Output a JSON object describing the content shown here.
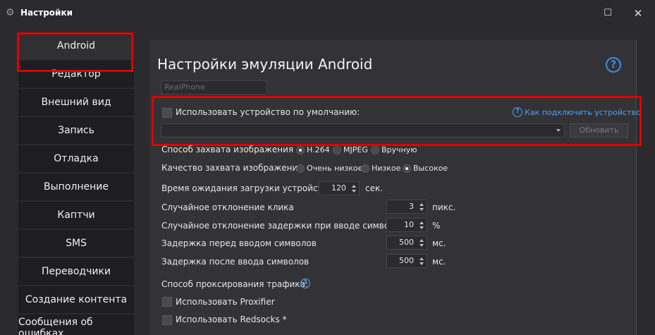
{
  "window": {
    "title": "Настройки",
    "maximize_glyph": "☐",
    "close_glyph": "✕"
  },
  "sidebar": {
    "items": [
      {
        "label": "Android",
        "active": true
      },
      {
        "label": "Редактор"
      },
      {
        "label": "Внешний вид"
      },
      {
        "label": "Запись"
      },
      {
        "label": "Отладка"
      },
      {
        "label": "Выполнение"
      },
      {
        "label": "Каптчи"
      },
      {
        "label": "SMS"
      },
      {
        "label": "Переводчики"
      },
      {
        "label": "Создание контента"
      },
      {
        "label": "Сообщения об ошибках"
      }
    ]
  },
  "main": {
    "title": "Настройки эмуляции Android",
    "help_glyph": "?",
    "device_name_value": "RealPhone",
    "default_device": {
      "checkbox_label": "Использовать устройство по умолчанию:",
      "checked": false,
      "help_link": "Как подключить устройство",
      "select_value": "",
      "refresh_button": "Обновить"
    },
    "capture_method": {
      "label": "Способ захвата изображения",
      "options": [
        "H.264",
        "MJPEG",
        "Вручную"
      ],
      "selected": "H.264"
    },
    "capture_quality": {
      "label": "Качество захвата изображения",
      "options": [
        "Очень низкое",
        "Низкое",
        "Высокое"
      ],
      "selected": "Высокое"
    },
    "load_timeout": {
      "label": "Время ожидания загрузки устройства",
      "value": "120",
      "unit": "сек."
    },
    "click_deviation": {
      "label": "Случайное отклонение клика",
      "value": "3",
      "unit": "пикс."
    },
    "typing_delay_deviation": {
      "label": "Случайное отклонение задержки при вводе символов",
      "value": "10",
      "unit": "%"
    },
    "delay_before_typing": {
      "label": "Задержка перед вводом символов",
      "value": "500",
      "unit": "мс."
    },
    "delay_after_typing": {
      "label": "Задержка после ввода символов",
      "value": "500",
      "unit": "мс."
    },
    "proxy": {
      "label": "Способ проксирования трафика:",
      "help_glyph": "?",
      "use_proxifier": "Использовать Proxifier",
      "use_redsocks": "Использовать Redsocks *"
    }
  },
  "colors": {
    "highlight_red": "#e00000",
    "link_blue": "#4aa0f0",
    "background": "#2b2b2e"
  }
}
